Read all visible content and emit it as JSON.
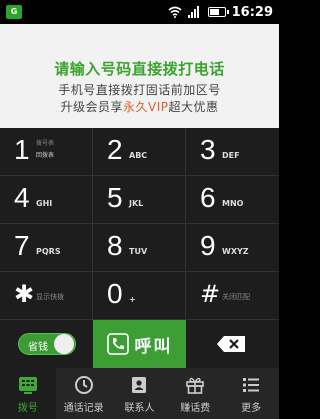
{
  "status_bar": {
    "app_badge": "G",
    "time": "16:29"
  },
  "message": {
    "headline": "请输入号码直接拨打电话",
    "line2": "手机号直接拨打固话前加区号",
    "line3_prefix": "升级会员享",
    "line3_highlight": "永久VIP",
    "line3_suffix": "超大优惠"
  },
  "keypad": {
    "k1": {
      "digit": "1",
      "top": "拨号表",
      "bottom": "回拨表"
    },
    "k2": {
      "digit": "2",
      "letters": "ABC"
    },
    "k3": {
      "digit": "3",
      "letters": "DEF"
    },
    "k4": {
      "digit": "4",
      "letters": "GHI"
    },
    "k5": {
      "digit": "5",
      "letters": "JKL"
    },
    "k6": {
      "digit": "6",
      "letters": "MNO"
    },
    "k7": {
      "digit": "7",
      "letters": "PQRS"
    },
    "k8": {
      "digit": "8",
      "letters": "TUV"
    },
    "k9": {
      "digit": "9",
      "letters": "WXYZ"
    },
    "kstar": {
      "symbol": "✱",
      "label": "显示快拨"
    },
    "k0": {
      "digit": "0",
      "letters": "+"
    },
    "khash": {
      "symbol": "#",
      "label": "关闭匹配"
    }
  },
  "actions": {
    "toggle_label": "省钱",
    "call_label": "呼叫"
  },
  "tabs": [
    {
      "label": "拨号",
      "icon": "keypad-icon",
      "active": true
    },
    {
      "label": "通话记录",
      "icon": "clock-icon",
      "active": false
    },
    {
      "label": "联系人",
      "icon": "contacts-icon",
      "active": false
    },
    {
      "label": "赚话费",
      "icon": "gift-icon",
      "active": false
    },
    {
      "label": "更多",
      "icon": "menu-icon",
      "active": false
    }
  ],
  "colors": {
    "accent_green": "#3aa42f",
    "highlight_orange": "#e8612c",
    "keypad_bg": "#1d1d1d"
  }
}
